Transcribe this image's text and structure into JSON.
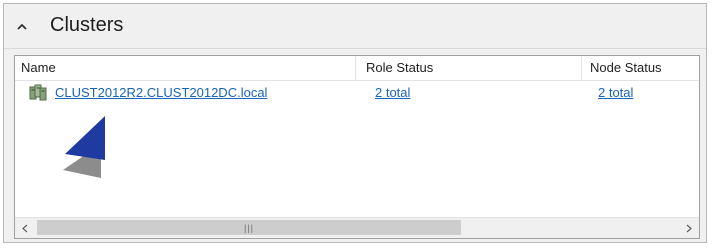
{
  "panel": {
    "title": "Clusters",
    "collapse_icon": "chevron-up-icon"
  },
  "columns": [
    "Name",
    "Role Status",
    "Node Status"
  ],
  "rows": [
    {
      "icon": "cluster-icon",
      "name": "CLUST2012R2.CLUST2012DC.local",
      "role_status": "2 total",
      "node_status": "2 total"
    }
  ],
  "scrollbar": {
    "left_icon": "scroll-left-icon",
    "right_icon": "scroll-right-icon",
    "grip_icon": "grip-icon"
  },
  "annotation": {
    "icon": "pointer-arrow-icon",
    "color": "#1f3aa0"
  },
  "colors": {
    "link": "#1a63b7",
    "panel_bg": "#f0f0f0"
  }
}
